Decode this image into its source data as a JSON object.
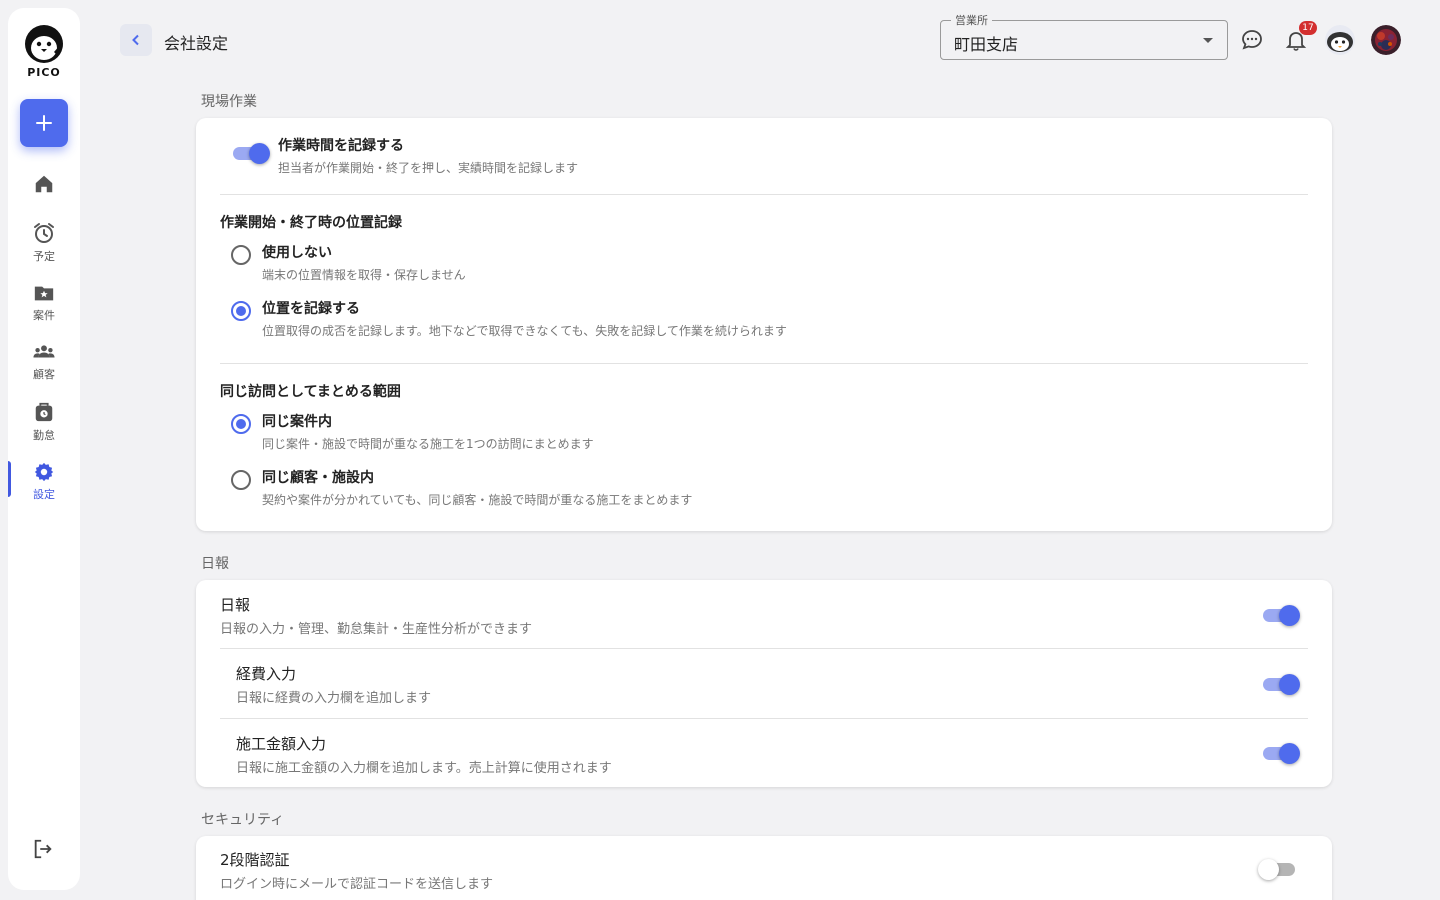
{
  "sidebar": {
    "logo_text": "PICO",
    "add_label": "+",
    "items": [
      {
        "label": ""
      },
      {
        "label": "予定"
      },
      {
        "label": "案件"
      },
      {
        "label": "顧客"
      },
      {
        "label": "勤怠"
      },
      {
        "label": "設定"
      }
    ]
  },
  "header": {
    "title": "会社設定",
    "office_select": {
      "legend": "営業所",
      "value": "町田支店"
    },
    "notification_count": "17"
  },
  "sections": {
    "field_work": {
      "label": "現場作業",
      "record_time": {
        "title": "作業時間を記録する",
        "desc": "担当者が作業開始・終了を押し、実績時間を記録します",
        "enabled": true
      },
      "location": {
        "heading": "作業開始・終了時の位置記録",
        "options": [
          {
            "title": "使用しない",
            "desc": "端末の位置情報を取得・保存しません",
            "checked": false
          },
          {
            "title": "位置を記録する",
            "desc": "位置取得の成否を記録します。地下などで取得できなくても、失敗を記録して作業を続けられます",
            "checked": true
          }
        ]
      },
      "visit_scope": {
        "heading": "同じ訪問としてまとめる範囲",
        "options": [
          {
            "title": "同じ案件内",
            "desc": "同じ案件・施設で時間が重なる施工を1つの訪問にまとめます",
            "checked": true
          },
          {
            "title": "同じ顧客・施設内",
            "desc": "契約や案件が分かれていても、同じ顧客・施設で時間が重なる施工をまとめます",
            "checked": false
          }
        ]
      }
    },
    "daily_report": {
      "label": "日報",
      "rows": [
        {
          "title": "日報",
          "desc": "日報の入力・管理、勤怠集計・生産性分析ができます",
          "enabled": true
        },
        {
          "title": "経費入力",
          "desc": "日報に経費の入力欄を追加します",
          "enabled": true
        },
        {
          "title": "施工金額入力",
          "desc": "日報に施工金額の入力欄を追加します。売上計算に使用されます",
          "enabled": true
        }
      ]
    },
    "security": {
      "label": "セキュリティ",
      "two_factor": {
        "title": "2段階認証",
        "desc": "ログイン時にメールで認証コードを送信します",
        "enabled": false
      }
    }
  },
  "colors": {
    "accent": "#4f6bed",
    "accent_light": "#9ba9f2",
    "badge": "#d32f2f"
  }
}
